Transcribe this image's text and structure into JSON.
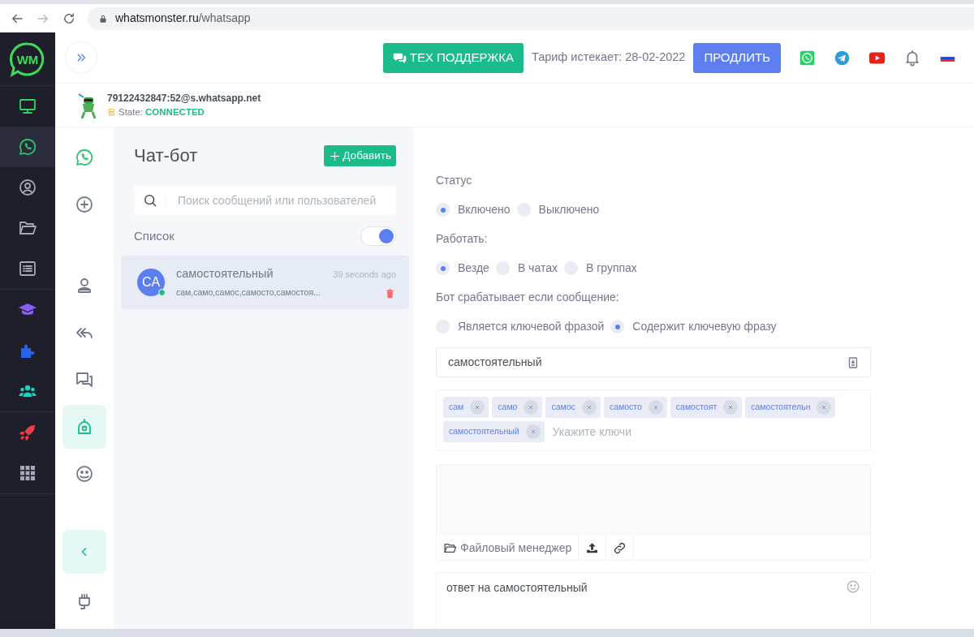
{
  "browser": {
    "url_host": "whatsmonster.ru",
    "url_path": "/whatsapp"
  },
  "left_nav": {
    "logo_text": "WM",
    "groups": [
      {
        "items": [
          {
            "kind": "monitor",
            "color": "#36d15a",
            "selected": false
          },
          {
            "kind": "chat-phone",
            "color": "#2fc36b",
            "selected": true
          },
          {
            "kind": "user-circle",
            "color": "#a4a7b5",
            "selected": false
          },
          {
            "kind": "folder",
            "color": "#a4a7b5",
            "selected": false
          },
          {
            "kind": "list",
            "color": "#a4a7b5",
            "selected": false
          }
        ]
      },
      {
        "items": [
          {
            "kind": "graduation",
            "color": "#8b5cf6",
            "selected": false
          },
          {
            "kind": "puzzle",
            "color": "#2563eb",
            "selected": false
          },
          {
            "kind": "people",
            "color": "#1fd1c1",
            "selected": false
          }
        ]
      },
      {
        "items": [
          {
            "kind": "rocket",
            "color": "#ef3b4b",
            "selected": false
          },
          {
            "kind": "grid",
            "color": "#a4a7b5",
            "selected": false
          }
        ]
      }
    ]
  },
  "header": {
    "support_button": "ТЕХ ПОДДЕРЖКА",
    "tariff": "Тариф истекает: 28-02-2022",
    "renew_button": "ПРОДЛИТЬ",
    "links": [
      {
        "kind": "phone"
      },
      {
        "kind": "plane"
      },
      {
        "kind": "play"
      },
      {
        "kind": "bell"
      },
      {
        "kind": "flag"
      }
    ]
  },
  "account": {
    "id": "79122432847:52@s.whatsapp.net",
    "state_label": "State:",
    "state_value": "CONNECTED"
  },
  "tool_nav": {
    "groups": [
      {
        "items": [
          {
            "kind": "chat-phone",
            "selected": false
          },
          {
            "kind": "plus-circle",
            "selected": false
          }
        ]
      },
      {
        "items": [
          {
            "kind": "person",
            "selected": false
          },
          {
            "kind": "reply-all",
            "selected": false
          },
          {
            "kind": "chats",
            "selected": false
          },
          {
            "kind": "bot",
            "selected": true
          },
          {
            "kind": "emoji",
            "selected": false
          }
        ]
      }
    ],
    "footer_items": [
      {
        "kind": "collapse"
      },
      {
        "kind": "plug"
      }
    ]
  },
  "chat_list": {
    "title": "Чат-бот",
    "add_button": "Добавить",
    "search": {
      "placeholder": "Поиск сообщений или пользователей"
    },
    "list_label": "Список",
    "list_toggle_on": true,
    "items": [
      {
        "avatar": "CA",
        "name": "самостоятельный",
        "time": "39 seconds ago",
        "preview": "сам,само,самос,самосто,самостоя...",
        "online": true,
        "selected": true
      }
    ]
  },
  "form": {
    "sections": [
      {
        "label": "Статус",
        "options": [
          {
            "label": "Включено",
            "selected": true
          },
          {
            "label": "Выключено",
            "selected": false
          }
        ]
      },
      {
        "label": "Работать:",
        "options": [
          {
            "label": "Везде",
            "selected": true
          },
          {
            "label": "В чатах",
            "selected": false
          },
          {
            "label": "В группах",
            "selected": false
          }
        ]
      },
      {
        "label": "Бот срабатывает если сообщение:",
        "options": [
          {
            "label": "Является ключевой фразой",
            "selected": false
          },
          {
            "label": "Содержит ключевую фразу",
            "selected": true
          }
        ]
      }
    ],
    "keyword": {
      "value": "самостоятельный"
    },
    "keys": {
      "tags": [
        "сам",
        "само",
        "самос",
        "самосто",
        "самостоят",
        "самостоятельн",
        "самостоятельный"
      ],
      "placeholder": "Укажите ключи"
    },
    "attachments": {
      "file_manager": "Файловый менеджер"
    },
    "reply": {
      "value": "ответ на самостоятельный"
    }
  }
}
